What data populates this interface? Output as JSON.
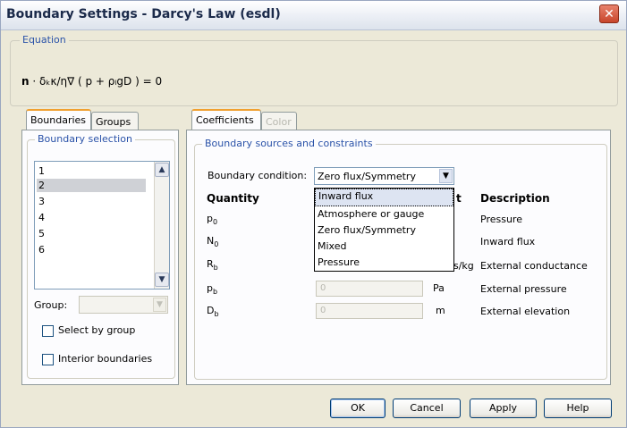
{
  "window": {
    "title": "Boundary Settings - Darcy's Law (esdl)",
    "close_glyph": "✕"
  },
  "equation": {
    "legend": "Equation",
    "bold": "n",
    "text": " · δₖκ/η∇ ( p + ρₗgD ) = 0"
  },
  "left_tabs": [
    {
      "label": "Boundaries"
    },
    {
      "label": "Groups"
    }
  ],
  "boundary_selection": {
    "legend": "Boundary selection",
    "items": [
      "1",
      "2",
      "3",
      "4",
      "5",
      "6"
    ],
    "selected_index": 1,
    "group_label": "Group:",
    "group_value": "",
    "select_by_group": "Select by group",
    "interior_boundaries": "Interior boundaries"
  },
  "right_tabs": [
    {
      "label": "Coefficients"
    },
    {
      "label": "Color"
    }
  ],
  "constraints": {
    "legend": "Boundary sources and constraints",
    "condition_label": "Boundary condition:",
    "condition_value": "Zero flux/Symmetry",
    "headers": {
      "quantity": "Quantity",
      "unit_partial": "t",
      "description": "Description"
    },
    "rows": [
      {
        "sym": "p",
        "sub": "0",
        "value": "",
        "unit": "",
        "desc": "Pressure"
      },
      {
        "sym": "N",
        "sub": "0",
        "value": "",
        "unit": "",
        "desc": "Inward flux"
      },
      {
        "sym": "R",
        "sub": "b",
        "value": "",
        "unit": "s/kg",
        "desc": "External conductance"
      },
      {
        "sym": "p",
        "sub": "b",
        "value": "0",
        "unit": "Pa",
        "desc": "External pressure"
      },
      {
        "sym": "D",
        "sub": "b",
        "value": "0",
        "unit": "m",
        "desc": "External elevation"
      }
    ],
    "dropdown_options": [
      "Inward flux",
      "Atmosphere or gauge",
      "Zero flux/Symmetry",
      "Mixed",
      "Pressure"
    ],
    "dropdown_highlight": 0
  },
  "buttons": {
    "ok": "OK",
    "cancel": "Cancel",
    "apply": "Apply",
    "help": "Help"
  }
}
